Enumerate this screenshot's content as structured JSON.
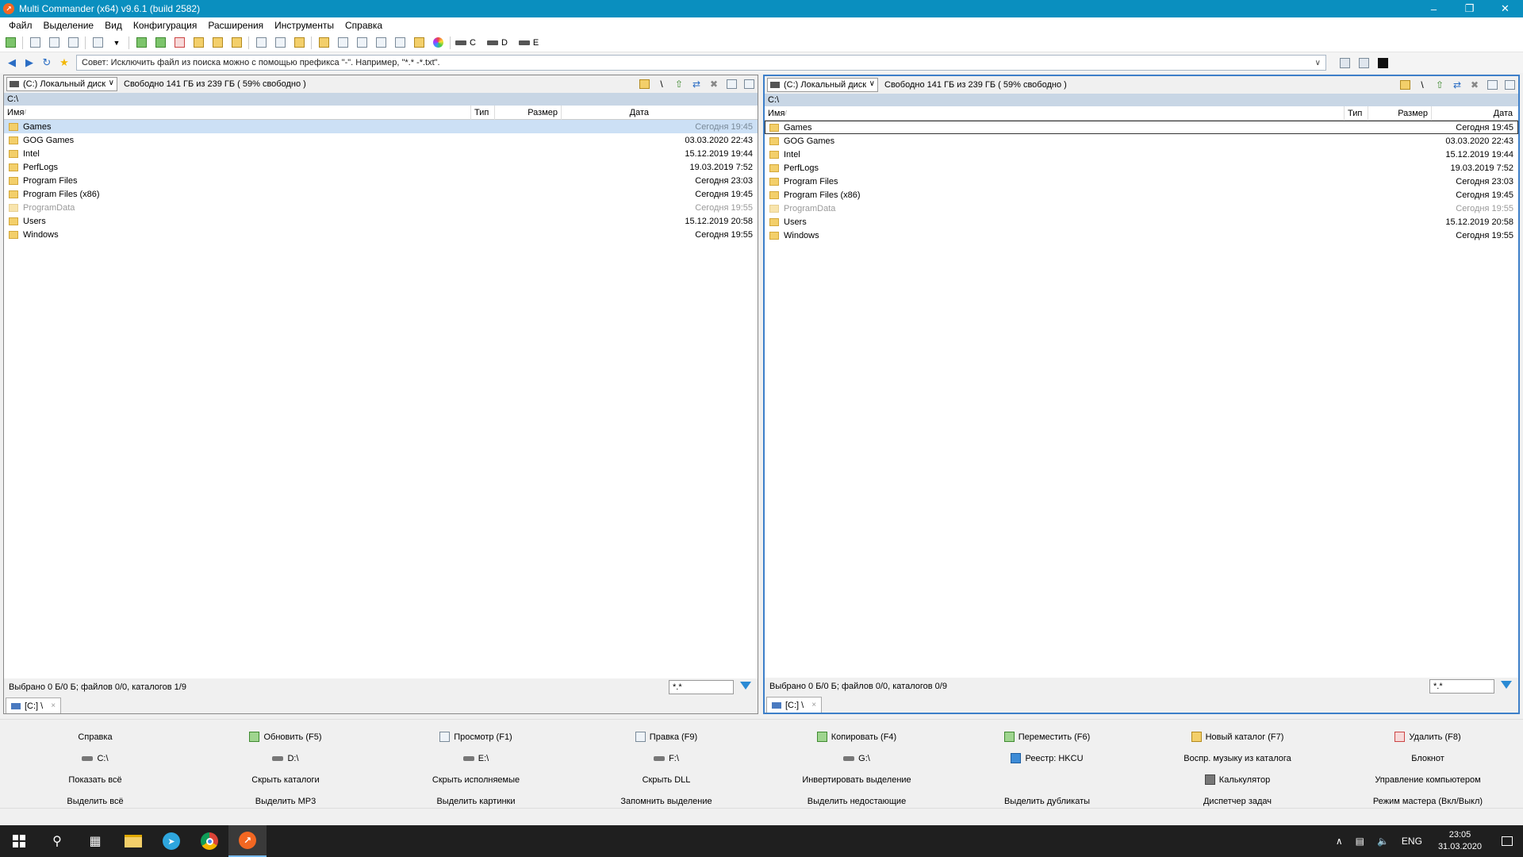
{
  "window": {
    "title": "Multi Commander (x64)  v9.6.1 (build 2582)",
    "app_icon": "multi-commander-logo-icon",
    "controls": {
      "minimize": "–",
      "maximize": "❐",
      "close": "✕"
    }
  },
  "menu": [
    "Файл",
    "Выделение",
    "Вид",
    "Конфигурация",
    "Расширения",
    "Инструменты",
    "Справка"
  ],
  "toolbar": {
    "drives": [
      "C",
      "D",
      "E"
    ]
  },
  "address_bar": {
    "tip": "Совет: Исключить файл из поиска можно с помощью префикса \"-\". Например, \"*.* -*.txt\"."
  },
  "columns": {
    "name": "Имя",
    "sort_mark": "/",
    "type": "Тип",
    "size": "Размер",
    "date": "Дата"
  },
  "left_panel": {
    "drive": "(C:) Локальный диск",
    "free": "Свободно 141 ГБ из 239 ГБ ( 59% свободно )",
    "path": "C:\\",
    "files": [
      {
        "name": "Games",
        "date": "Сегодня 19:45",
        "hidden": false
      },
      {
        "name": "GOG Games",
        "date": "03.03.2020 22:43",
        "hidden": false
      },
      {
        "name": "Intel",
        "date": "15.12.2019 19:44",
        "hidden": false
      },
      {
        "name": "PerfLogs",
        "date": "19.03.2019 7:52",
        "hidden": false
      },
      {
        "name": "Program Files",
        "date": "Сегодня 23:03",
        "hidden": false
      },
      {
        "name": "Program Files (x86)",
        "date": "Сегодня 19:45",
        "hidden": false
      },
      {
        "name": "ProgramData",
        "date": "Сегодня 19:55",
        "hidden": true
      },
      {
        "name": "Users",
        "date": "15.12.2019 20:58",
        "hidden": false
      },
      {
        "name": "Windows",
        "date": "Сегодня 19:55",
        "hidden": false
      }
    ],
    "status": "Выбрано 0 Б/0 Б; файлов 0/0, каталогов 1/9",
    "filter": "*.*",
    "tab": "[C:] \\",
    "tab_close": "×"
  },
  "right_panel": {
    "drive": "(C:) Локальный диск",
    "free": "Свободно 141 ГБ из 239 ГБ ( 59% свободно )",
    "path": "C:\\",
    "files": [
      {
        "name": "Games",
        "date": "Сегодня 19:45",
        "hidden": false
      },
      {
        "name": "GOG Games",
        "date": "03.03.2020 22:43",
        "hidden": false
      },
      {
        "name": "Intel",
        "date": "15.12.2019 19:44",
        "hidden": false
      },
      {
        "name": "PerfLogs",
        "date": "19.03.2019 7:52",
        "hidden": false
      },
      {
        "name": "Program Files",
        "date": "Сегодня 23:03",
        "hidden": false
      },
      {
        "name": "Program Files (x86)",
        "date": "Сегодня 19:45",
        "hidden": false
      },
      {
        "name": "ProgramData",
        "date": "Сегодня 19:55",
        "hidden": true
      },
      {
        "name": "Users",
        "date": "15.12.2019 20:58",
        "hidden": false
      },
      {
        "name": "Windows",
        "date": "Сегодня 19:55",
        "hidden": false
      }
    ],
    "status": "Выбрано 0 Б/0 Б; файлов 0/0, каталогов 0/9",
    "filter": "*.*",
    "tab": "[C:] \\",
    "tab_close": "×"
  },
  "button_bar": [
    [
      {
        "label": "Справка",
        "icon": ""
      },
      {
        "label": "Обновить (F5)",
        "icon": "refresh-icon"
      },
      {
        "label": "Просмотр (F1)",
        "icon": "view-icon"
      },
      {
        "label": "Правка (F9)",
        "icon": "edit-icon"
      },
      {
        "label": "Копировать (F4)",
        "icon": "copy-icon"
      },
      {
        "label": "Переместить (F6)",
        "icon": "move-icon"
      },
      {
        "label": "Новый каталог (F7)",
        "icon": "new-folder-icon"
      },
      {
        "label": "Удалить (F8)",
        "icon": "delete-icon"
      }
    ],
    [
      {
        "label": "C:\\",
        "icon": "drive-icon"
      },
      {
        "label": "D:\\",
        "icon": "drive-icon"
      },
      {
        "label": "E:\\",
        "icon": "drive-icon"
      },
      {
        "label": "F:\\",
        "icon": "drive-icon"
      },
      {
        "label": "G:\\",
        "icon": "drive-icon"
      },
      {
        "label": "Реестр: HKCU",
        "icon": "registry-icon"
      },
      {
        "label": "Воспр. музыку из каталога",
        "icon": ""
      },
      {
        "label": "Блокнот",
        "icon": ""
      }
    ],
    [
      {
        "label": "Показать всё",
        "icon": ""
      },
      {
        "label": "Скрыть каталоги",
        "icon": ""
      },
      {
        "label": "Скрыть исполняемые",
        "icon": ""
      },
      {
        "label": "Скрыть DLL",
        "icon": ""
      },
      {
        "label": "Инвертировать выделение",
        "icon": ""
      },
      {
        "label": "",
        "icon": ""
      },
      {
        "label": "Калькулятор",
        "icon": "calculator-icon"
      },
      {
        "label": "Управление компьютером",
        "icon": ""
      }
    ],
    [
      {
        "label": "Выделить всё",
        "icon": ""
      },
      {
        "label": "Выделить MP3",
        "icon": ""
      },
      {
        "label": "Выделить картинки",
        "icon": ""
      },
      {
        "label": "Запомнить выделение",
        "icon": ""
      },
      {
        "label": "Выделить недостающие",
        "icon": ""
      },
      {
        "label": "Выделить дубликаты",
        "icon": ""
      },
      {
        "label": "Диспетчер задач",
        "icon": ""
      },
      {
        "label": "Режим мастера (Вкл/Выкл)",
        "icon": ""
      }
    ]
  ],
  "taskbar": {
    "tray_lang": "ENG",
    "time": "23:05",
    "date": "31.03.2020"
  }
}
